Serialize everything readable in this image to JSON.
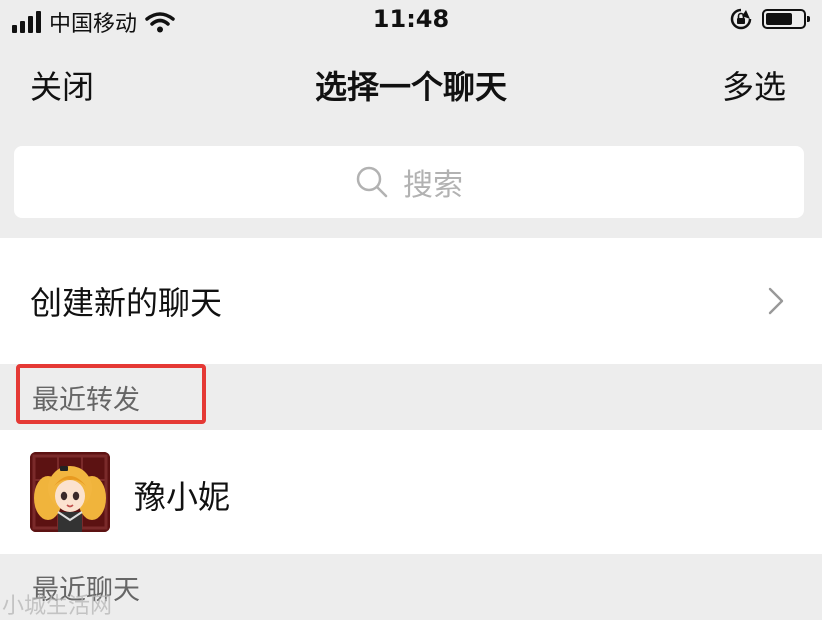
{
  "status_bar": {
    "carrier": "中国移动",
    "time": "11:48"
  },
  "nav": {
    "close_label": "关闭",
    "title": "选择一个聊天",
    "multi_select_label": "多选"
  },
  "search": {
    "placeholder": "搜索"
  },
  "create_new_chat": {
    "label": "创建新的聊天"
  },
  "sections": {
    "recent_forward": "最近转发",
    "recent_chats": "最近聊天"
  },
  "contacts": [
    {
      "name": "豫小妮"
    }
  ],
  "watermark": "小城生活网",
  "colors": {
    "highlight_box": "#e53935",
    "background": "#ededed",
    "row_background": "#ffffff"
  }
}
